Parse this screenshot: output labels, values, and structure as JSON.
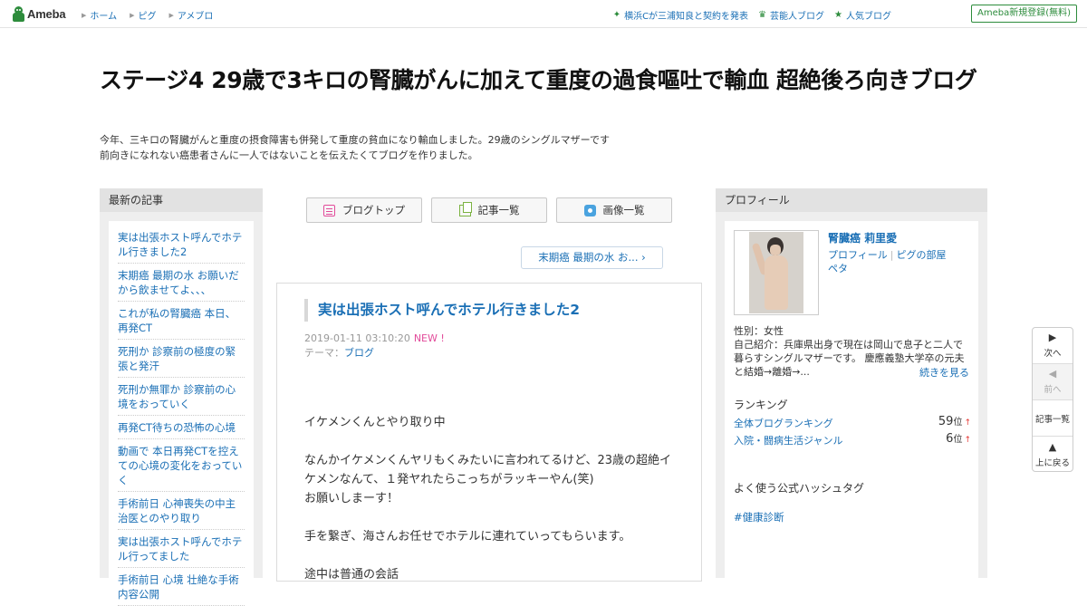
{
  "header": {
    "logo_text": "Ameba",
    "nav": [
      "ホーム",
      "ピグ",
      "アメブロ"
    ],
    "links": [
      {
        "label": "横浜Cが三浦知良と契約を発表",
        "icon": "sparkle-icon"
      },
      {
        "label": "芸能人ブログ",
        "icon": "crown-icon"
      },
      {
        "label": "人気ブログ",
        "icon": "star-icon"
      }
    ],
    "register_label": "Ameba新規登録(無料)"
  },
  "blog": {
    "title": "ステージ4 29歳で3キロの腎臓がんに加えて重度の過食嘔吐で輸血 超絶後ろ向きブログ",
    "description_lines": [
      "今年、三キロの腎臓がんと重度の摂食障害も併発して重度の貧血になり輸血しました。29歳のシングルマザーです",
      "前向きになれない癌患者さんに一人ではないことを伝えたくてブログを作りました。"
    ]
  },
  "sidebar_left": {
    "heading": "最新の記事",
    "items": [
      "実は出張ホスト呼んでホテル行きました2",
      "末期癌 最期の水 お願いだから飲ませてよ、、、",
      "これが私の腎臓癌 本日、再発CT",
      "死刑か 診察前の極度の緊張と発汗",
      "死刑か無罪か 診察前の心境をおっていく",
      "再発CT待ちの恐怖の心境",
      "動画で 本日再発CTを控えての心境の変化をおっていく",
      "手術前日 心神喪失の中主治医とのやり取り",
      "実は出張ホスト呼んでホテル行ってました",
      "手術前日 心境 壮絶な手術内容公開"
    ]
  },
  "main": {
    "buttons": [
      {
        "label": "ブログトップ",
        "icon": "blog-top-icon"
      },
      {
        "label": "記事一覧",
        "icon": "article-list-icon"
      },
      {
        "label": "画像一覧",
        "icon": "camera-icon"
      }
    ],
    "next_article": "末期癌 最期の水 お...",
    "article": {
      "title": "実は出張ホスト呼んでホテル行きました2",
      "date": "2019-01-11 03:10:20",
      "new_badge": "NEW !",
      "theme_label": "テーマ：",
      "theme": "ブログ",
      "paragraphs": [
        "イケメンくんとやり取り中",
        "なんかイケメンくんヤリもくみたいに言われてるけど、23歳の超絶イケメンなんて、１発ヤれたらこっちがラッキーやん(笑)\nお願いしまーす！",
        "手を繋ぎ、海さんお任せでホテルに連れていってもらいます。",
        "途中は普通の会話"
      ]
    }
  },
  "sidebar_right": {
    "heading": "プロフィール",
    "name": "腎臓癌 莉里愛",
    "links": [
      "プロフィール",
      "ピグの部屋",
      "ペタ"
    ],
    "gender": "性別：女性",
    "intro": "自己紹介：兵庫県出身で現在は岡山で息子と二人で暮らすシングルマザーです。 慶應義塾大学卒の元夫と結婚→離婚→...",
    "more": "続きを見る",
    "ranking_heading": "ランキング",
    "rankings": [
      {
        "label": "全体ブログランキング",
        "value": "59",
        "unit": "位",
        "trend": "↑"
      },
      {
        "label": "入院・闘病生活ジャンル",
        "value": "6",
        "unit": "位",
        "trend": "↑"
      }
    ],
    "hashtag_heading": "よく使う公式ハッシュタグ",
    "hashtag": "#健康診断"
  },
  "sidenav": [
    {
      "label": "次へ",
      "icon": "triangle-right-icon",
      "enabled": true
    },
    {
      "label": "前へ",
      "icon": "triangle-left-icon",
      "enabled": false
    },
    {
      "label": "記事一覧",
      "icon": "",
      "enabled": true
    },
    {
      "label": "上に戻る",
      "icon": "triangle-up-icon",
      "enabled": true
    }
  ],
  "colors": {
    "brand_green": "#2d8c3c",
    "link_blue": "#1a6fb5",
    "new_pink": "#e24b9a",
    "rank_up_red": "#e53935"
  }
}
